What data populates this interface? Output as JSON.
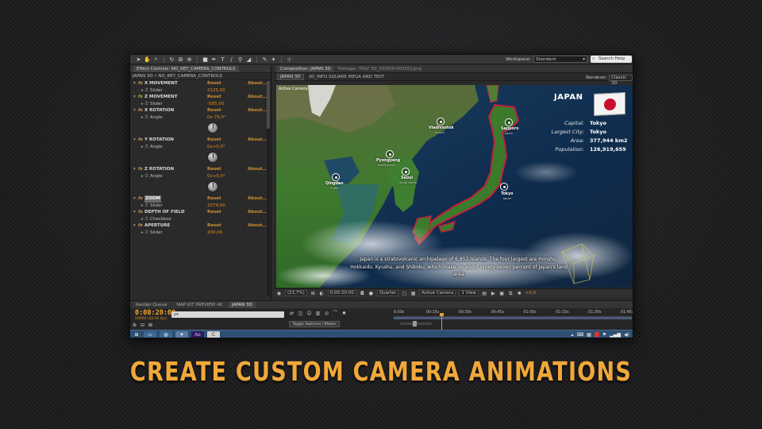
{
  "toolbar": {
    "workspace_label": "Workspace:",
    "workspace_value": "Standard",
    "search_placeholder": "Search Help"
  },
  "effect_controls": {
    "tab_label": "Effect Controls: NO_KEY_CAMERA_CONTROLS",
    "breadcrumb": "JAPAN 3D • NO_KEY_CAMERA_CONTROLS",
    "reset_label": "Reset",
    "about_label": "About...",
    "effects": [
      {
        "name": "X MOVEMENT",
        "param": "Slider",
        "value": "2125,00",
        "dial": false
      },
      {
        "name": "Z MOVEMENT",
        "param": "Slider",
        "value": "-585,00",
        "dial": false
      },
      {
        "name": "X ROTATION",
        "param": "Angle",
        "value": "0x-79,0°",
        "dial": true
      },
      {
        "name": "Y ROTATION",
        "param": "Angle",
        "value": "0x+0,0°",
        "dial": true
      },
      {
        "name": "Z ROTATION",
        "param": "Angle",
        "value": "0x+0,0°",
        "dial": true
      },
      {
        "name": "ZOOM",
        "param": "Slider",
        "value": "2079,00",
        "dial": false
      },
      {
        "name": "DEPTH OF FIELD",
        "param": "Checkbox",
        "value": "",
        "dial": false
      },
      {
        "name": "APERTURE",
        "param": "Slider",
        "value": "200,00",
        "dial": false
      }
    ]
  },
  "composition": {
    "tab_label": "Composition: JAPAN 3D",
    "footage_label": "Footage: ITALY 3D_[00000-00250].png",
    "sub_tab": "JAPAN 3D",
    "sub_path": "3D_INFO SQUARE MEGA AND TEXT",
    "renderer_label": "Renderer:",
    "renderer_value": "Classic 3D",
    "viewer_label": "Active Camera"
  },
  "map": {
    "title": "JAPAN",
    "info": [
      {
        "key": "Capital:",
        "value": "Tokyo"
      },
      {
        "key": "Largest City:",
        "value": "Tokyo"
      },
      {
        "key": "Area:",
        "value": "377,944 km2"
      },
      {
        "key": "Population:",
        "value": "126,919,659"
      }
    ],
    "cities": [
      {
        "name": "Vladivostok",
        "country": "Russia"
      },
      {
        "name": "Sapporo",
        "country": "Japan"
      },
      {
        "name": "Pyongyang",
        "country": "North Korea"
      },
      {
        "name": "Seoul",
        "country": "South Korea"
      },
      {
        "name": "Qingdao",
        "country": "China"
      },
      {
        "name": "Tokyo",
        "country": "Japan"
      }
    ],
    "caption": "Japan is a stratovolcanic archipelago of 6,852 islands. The four largest are Honshu, Hokkaido, Kyushu, and Shikoku, which make up about ninety-seven percent of Japan's land area"
  },
  "comp_footer": {
    "magnification": "(23,7%)",
    "timecode": "0:00:20:00",
    "resolution": "Quarter",
    "camera": "Active Camera",
    "views": "1 View",
    "exposure": "+0,0"
  },
  "timeline": {
    "tabs": [
      "Render Queue",
      "MAP KIT PREVIEW 4K",
      "JAPAN 3D"
    ],
    "timecode": "0:00:20:00",
    "frame_info": "00600 (30.00 fps)",
    "search_placeholder": "ρ▾",
    "ticks": [
      "0:00s",
      "00:15s",
      "00:30s",
      "00:45s",
      "01:00s",
      "01:15s",
      "01:30s",
      "01:45s"
    ],
    "toggle_label": "Toggle Switches / Modes"
  },
  "headline": "CREATE CUSTOM CAMERA ANIMATIONS",
  "colors": {
    "accent_orange": "#f0a83a",
    "timecode_orange": "#f1a22a",
    "japan_outline": "#c0203a"
  }
}
